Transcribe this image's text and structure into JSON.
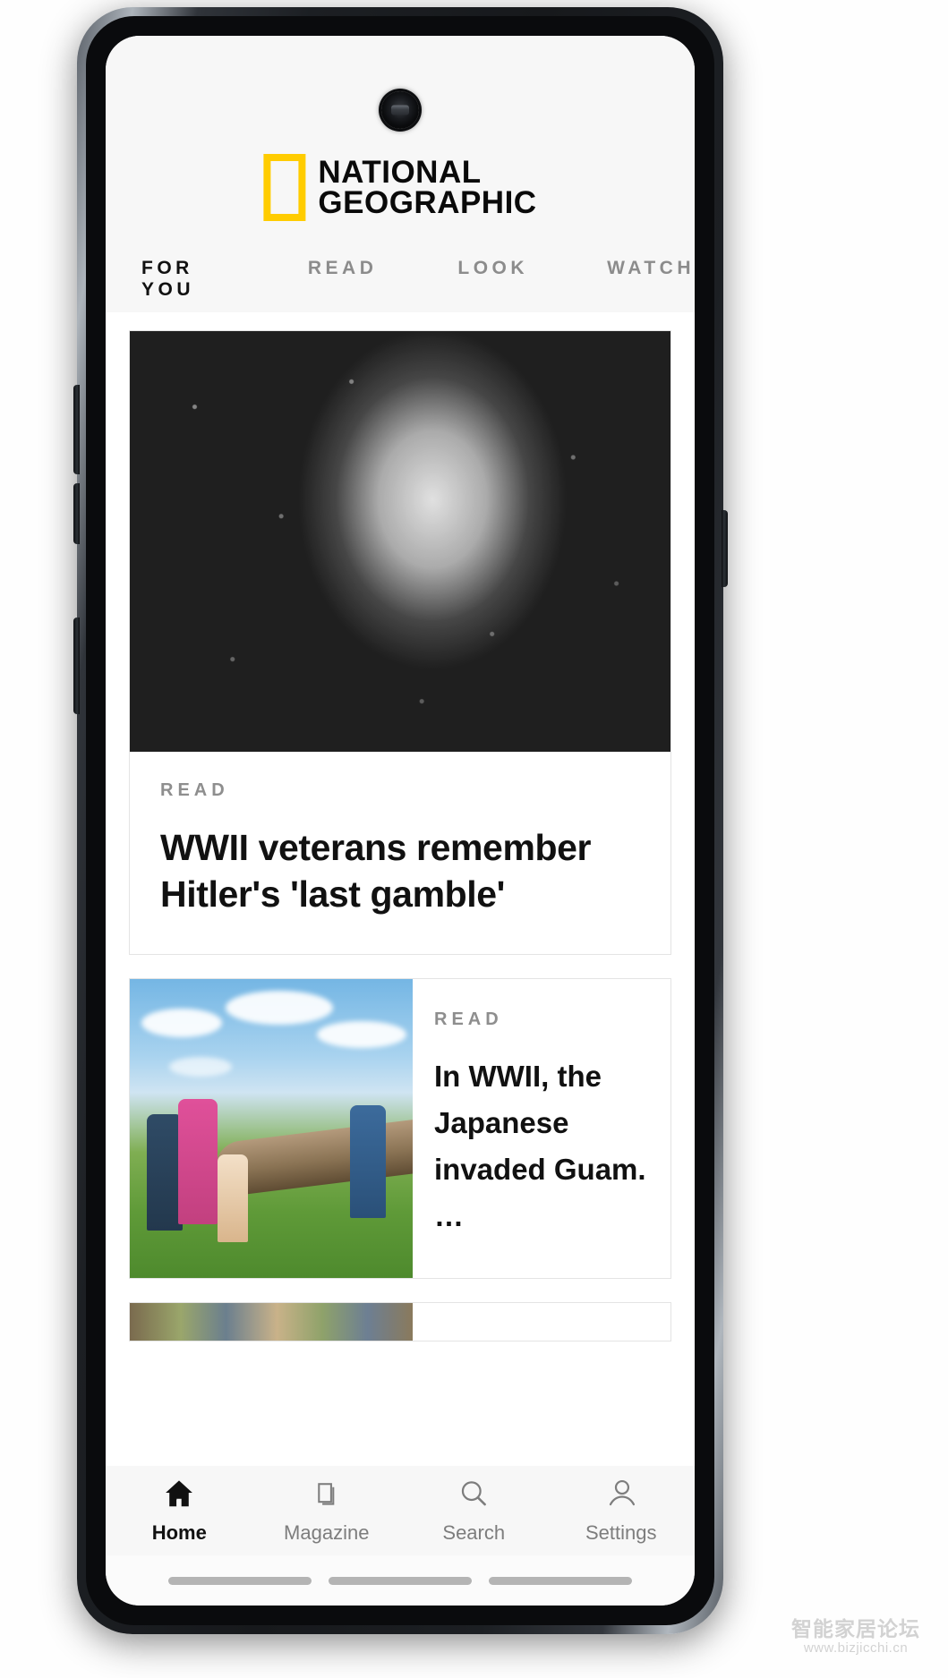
{
  "app": {
    "name": "National Geographic",
    "logo": {
      "line1": "NATIONAL",
      "line2": "GEOGRAPHIC",
      "accent": "#ffcc00"
    }
  },
  "tabs": [
    {
      "id": "for-you",
      "label": "FOR YOU",
      "active": true
    },
    {
      "id": "read",
      "label": "READ",
      "active": false
    },
    {
      "id": "look",
      "label": "LOOK",
      "active": false
    },
    {
      "id": "watch",
      "label": "WATCH",
      "active": false
    }
  ],
  "feed": {
    "hero": {
      "kicker": "READ",
      "headline": "WWII veterans remember Hitler's 'last gamble'",
      "image_alt": "Black and white photo of a WWII soldier in a snow covered knit cap and coat"
    },
    "second": {
      "kicker": "READ",
      "headline": "In WWII, the Japanese invaded Guam. …",
      "image_alt": "Family taking a selfie beside a rusted aircraft propeller on a grass field"
    },
    "third": {
      "image_alt": "Partially visible photo of people outdoors"
    }
  },
  "bottom_nav": [
    {
      "id": "home",
      "label": "Home",
      "icon": "home-icon",
      "active": true
    },
    {
      "id": "magazine",
      "label": "Magazine",
      "icon": "magazine-icon",
      "active": false
    },
    {
      "id": "search",
      "label": "Search",
      "icon": "search-icon",
      "active": false
    },
    {
      "id": "settings",
      "label": "Settings",
      "icon": "person-icon",
      "active": false
    }
  ],
  "watermark": {
    "line1": "智能家居论坛",
    "line2": "www.bizjicchi.cn"
  },
  "colors": {
    "accent_yellow": "#ffcc00",
    "tab_underline": "#f0c040",
    "active_text": "#111111",
    "muted_text": "#8c8c8c",
    "app_bg": "#f7f7f7"
  }
}
